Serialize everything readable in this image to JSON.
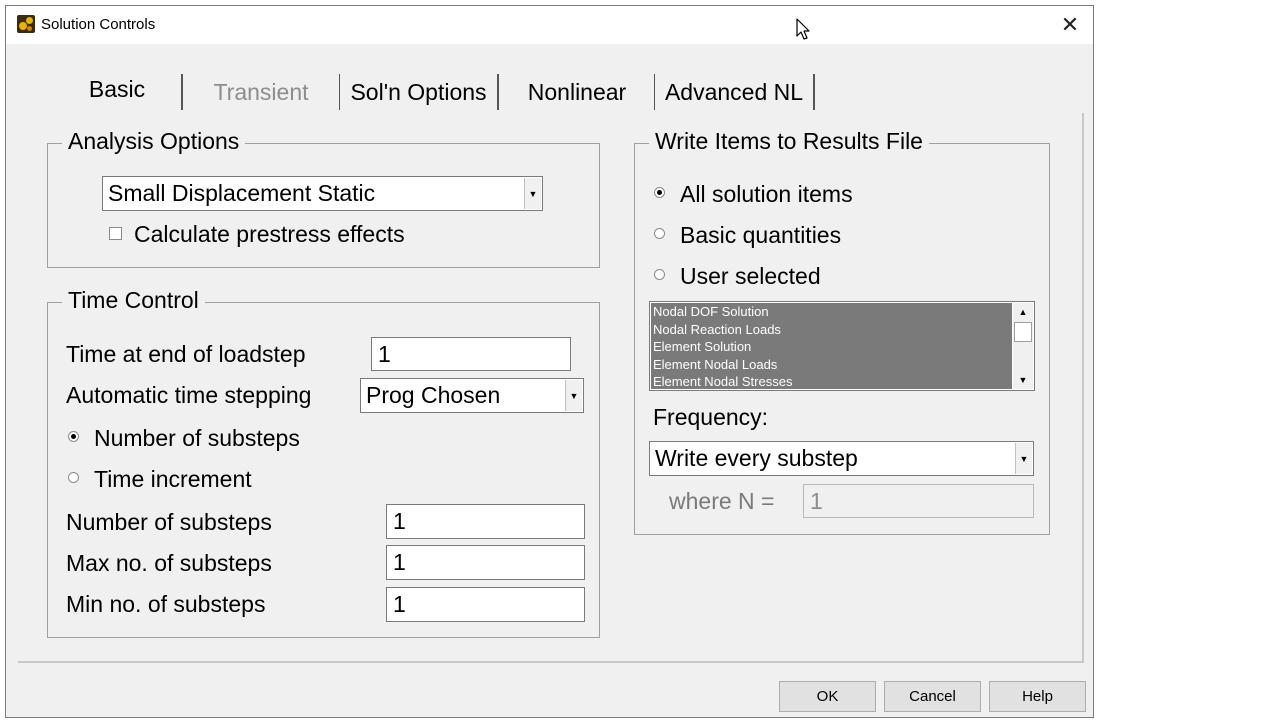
{
  "window": {
    "title": "Solution Controls",
    "close_glyph": "✕"
  },
  "tabs": [
    {
      "label": "Basic",
      "selected": true
    },
    {
      "label": "Transient",
      "enabled": false
    },
    {
      "label": "Sol'n Options"
    },
    {
      "label": "Nonlinear"
    },
    {
      "label": "Advanced NL"
    }
  ],
  "analysis_options": {
    "legend": "Analysis Options",
    "analysis_type": "Small Displacement Static",
    "prestress_label": "Calculate prestress effects",
    "prestress_checked": false
  },
  "time_control": {
    "legend": "Time Control",
    "time_end_label": "Time at end of loadstep",
    "time_end_value": "1",
    "auto_step_label": "Automatic time stepping",
    "auto_step_value": "Prog Chosen",
    "radio_substeps_label": "Number of substeps",
    "radio_increment_label": "Time increment",
    "selected_radio": "substeps",
    "num_substeps_label": "Number of substeps",
    "num_substeps_value": "1",
    "max_substeps_label": "Max no. of substeps",
    "max_substeps_value": "1",
    "min_substeps_label": "Min no. of substeps",
    "min_substeps_value": "1"
  },
  "results": {
    "legend": "Write Items to Results File",
    "radio_all_label": "All solution items",
    "radio_basic_label": "Basic quantities",
    "radio_user_label": "User selected",
    "selected_radio": "all",
    "items": [
      "Nodal DOF Solution",
      "Nodal Reaction Loads",
      "Element Solution",
      "Element Nodal Loads",
      "Element Nodal Stresses"
    ],
    "frequency_label": "Frequency:",
    "frequency_value": "Write every substep",
    "where_n_label": "where N =",
    "where_n_value": "1"
  },
  "buttons": {
    "ok": "OK",
    "cancel": "Cancel",
    "help": "Help"
  },
  "colors": {
    "dialog_bg": "#f0f0f0",
    "list_bg": "#7a7a7a",
    "disabled_text": "#8d8d8d"
  }
}
